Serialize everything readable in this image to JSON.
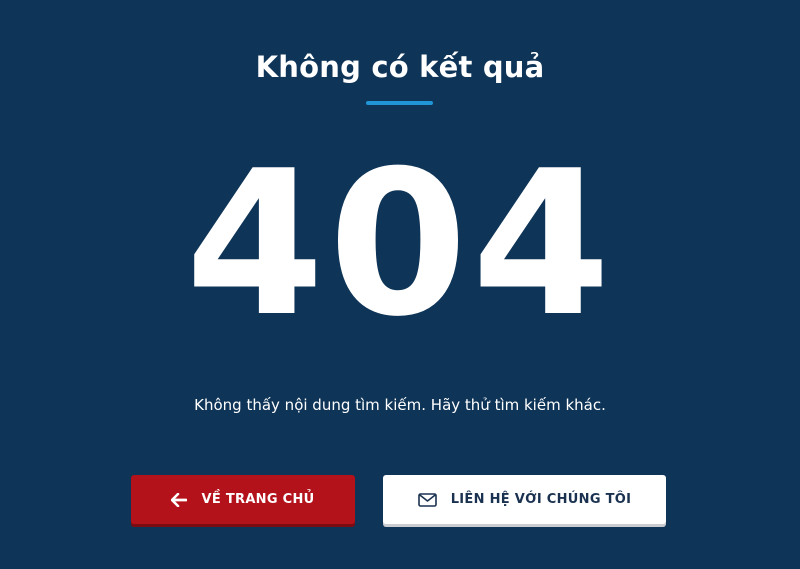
{
  "page": {
    "title": "Không có kết quả",
    "error_code": "404",
    "message": "Không thấy nội dung tìm kiếm. Hãy thử tìm kiếm khác."
  },
  "actions": {
    "home_label": "VỀ TRANG CHỦ",
    "home_icon": "arrow-left-icon",
    "contact_label": "LIÊN HỆ VỚI CHÚNG TÔI",
    "contact_icon": "mail-icon"
  },
  "colors": {
    "background": "#0e3457",
    "accent": "#2196d6",
    "home_button": "#b4121b",
    "contact_button": "#ffffff"
  }
}
